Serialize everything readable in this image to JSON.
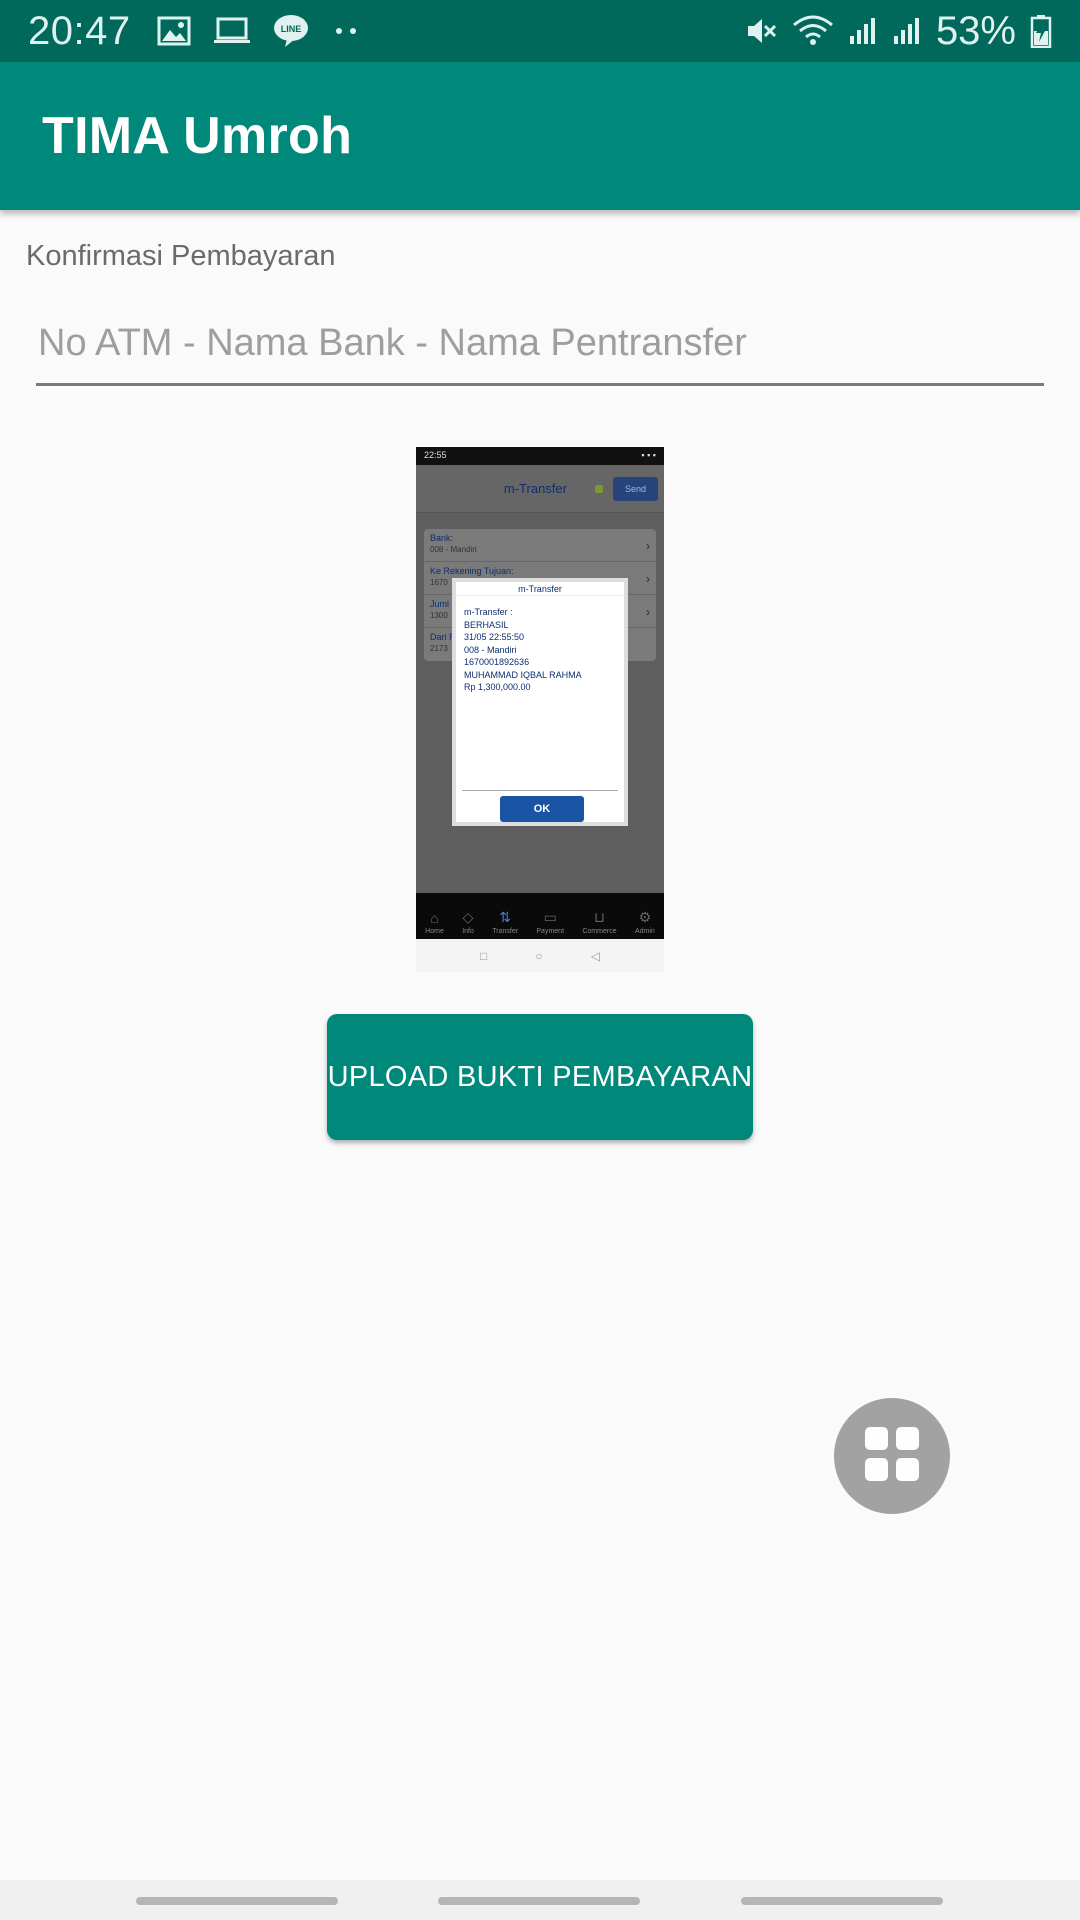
{
  "status_bar": {
    "time": "20:47",
    "battery_percent": "53%",
    "left_icons": [
      "gallery-icon",
      "laptop-icon",
      "line-app-icon",
      "more-dots-icon"
    ],
    "right_icons": [
      "vibrate-mute-icon",
      "wifi-icon",
      "signal-icon",
      "signal-icon",
      "battery-charging-icon"
    ],
    "color": "#00695c"
  },
  "app_bar": {
    "title": "TIMA Umroh",
    "color": "#00897b"
  },
  "form": {
    "label": "Konfirmasi Pembayaran",
    "input_value": "",
    "input_placeholder": "No ATM - Nama Bank - Nama Pentransfer"
  },
  "preview": {
    "status_time": "22:55",
    "header_title": "m-Transfer",
    "send_label": "Send",
    "rows": [
      {
        "label": "Bank:",
        "value": "008 - Mandiri"
      },
      {
        "label": "Ke Rekening Tujuan:",
        "value": "1670"
      },
      {
        "label": "Juml",
        "value": "1300"
      },
      {
        "label": "Dari R",
        "value": "2173"
      }
    ],
    "dialog_title": "m-Transfer",
    "dialog_lines": [
      "m-Transfer :",
      "BERHASIL",
      "31/05 22:55:50",
      "008 - Mandiri",
      "1670001892636",
      "MUHAMMAD IQBAL RAHMA",
      "Rp 1,300,000.00"
    ],
    "ok_label": "OK",
    "nav_items": [
      "Home",
      "Info",
      "Transfer",
      "Payment",
      "Commerce",
      "Admin"
    ]
  },
  "upload_button": {
    "label": "UPLOAD BUKTI PEMBAYARAN"
  },
  "fab": {
    "icon": "grid-apps-icon"
  }
}
